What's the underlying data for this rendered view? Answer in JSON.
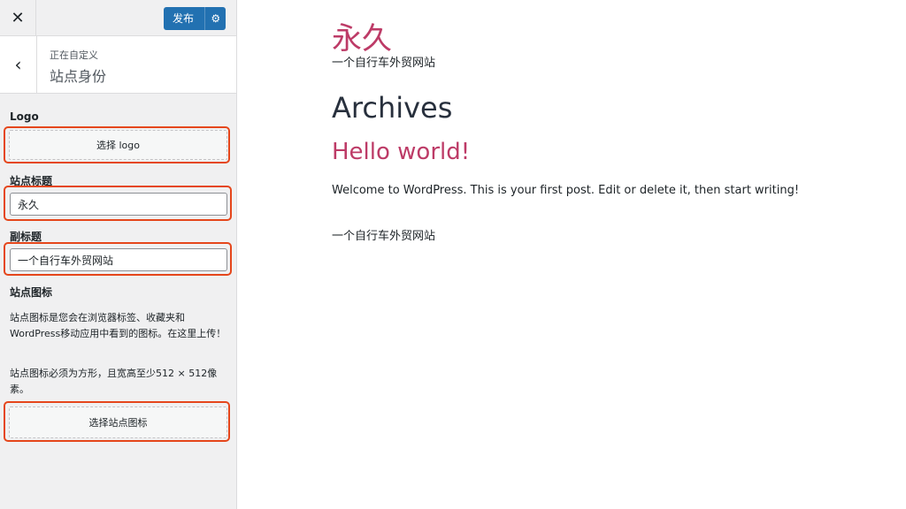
{
  "topbar": {
    "close_glyph": "✕",
    "publish_label": "发布",
    "gear_glyph": "⚙"
  },
  "section_header": {
    "back_glyph": "‹",
    "customizing_label": "正在自定义",
    "title": "站点身份"
  },
  "logo": {
    "label": "Logo",
    "button_label": "选择 logo"
  },
  "site_title": {
    "label": "站点标题",
    "value": "永久"
  },
  "tagline": {
    "label": "副标题",
    "value": "一个自行车外贸网站"
  },
  "site_icon": {
    "label": "站点图标",
    "description_1": "站点图标是您会在浏览器标签、收藏夹和WordPress移动应用中看到的图标。在这里上传！",
    "description_2": "站点图标必须为方形，且宽高至少512 × 512像素。",
    "button_label": "选择站点图标"
  },
  "preview": {
    "site_title": "永久",
    "site_tagline": "一个自行车外贸网站",
    "archives_title": "Archives",
    "post_title": "Hello world!",
    "post_excerpt": "Welcome to WordPress. This is your first post. Edit or delete it, then start writing!",
    "footer_tagline": "一个自行车外贸网站"
  },
  "colors": {
    "accent": "#2271b1",
    "link": "#bd3b67",
    "highlight": "#e5461b"
  }
}
